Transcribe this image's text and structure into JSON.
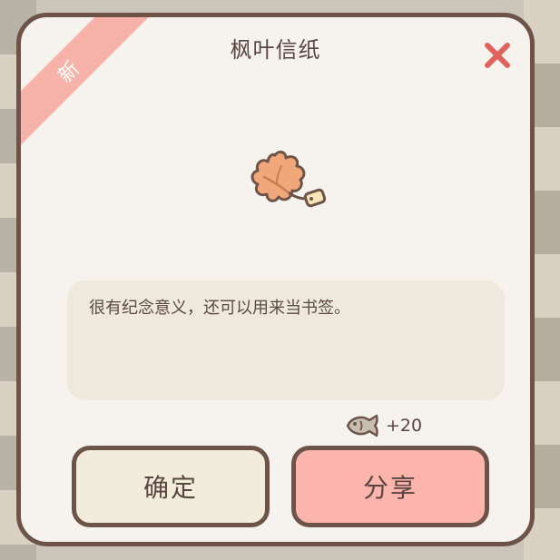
{
  "dialog": {
    "ribbon_label": "新",
    "title": "枫叶信纸",
    "item_icon": "maple-leaf-letter-icon",
    "description": "很有纪念意义，还可以用来当书签。",
    "reward": {
      "icon": "fish-icon",
      "amount": "+20"
    },
    "buttons": {
      "confirm_label": "确定",
      "share_label": "分享"
    }
  },
  "colors": {
    "background": "#f6f3ee",
    "border": "#6e5448",
    "ribbon": "#f7b3aa",
    "close_icon": "#e0635e",
    "desc_box": "#efe9dd",
    "confirm_button": "#f2ecdd",
    "share_button": "#fbb5ad",
    "text": "#5a4640"
  }
}
